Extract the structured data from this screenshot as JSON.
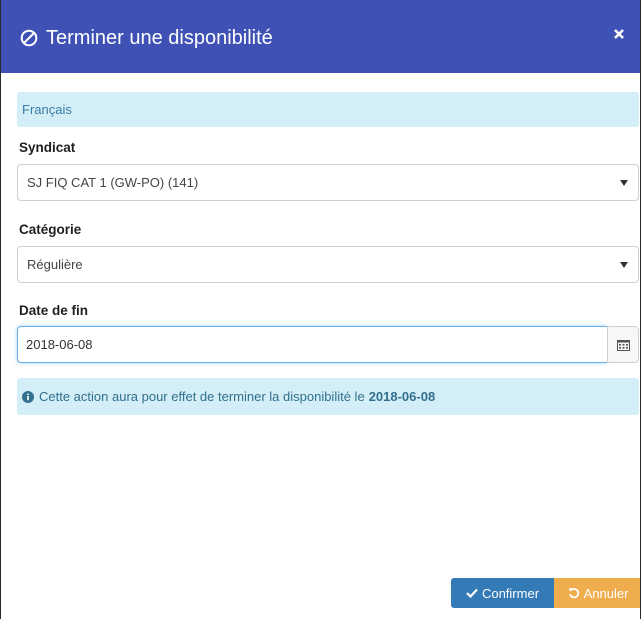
{
  "header": {
    "title": "Terminer une disponibilité",
    "title_icon": "ban-icon",
    "close_icon": "close-icon",
    "color": "#3f51b5"
  },
  "language_bar": {
    "label": "Français"
  },
  "form": {
    "syndicat": {
      "label": "Syndicat",
      "selected": "SJ FIQ CAT 1 (GW-PO) (141)"
    },
    "categorie": {
      "label": "Catégorie",
      "selected": "Régulière"
    },
    "date_fin": {
      "label": "Date de fin",
      "value": "2018-06-08",
      "addon_icon": "calendar-icon"
    }
  },
  "info_alert": {
    "icon": "info-circle-icon",
    "text": "Cette action aura pour effet de terminer la disponibilité le",
    "date": "2018-06-08"
  },
  "footer": {
    "confirm_label": "Confirmer",
    "confirm_icon": "check-icon",
    "cancel_label": "Annuler",
    "cancel_icon": "undo-icon",
    "confirm_color": "#337ab7",
    "cancel_color": "#f0ad4e"
  }
}
